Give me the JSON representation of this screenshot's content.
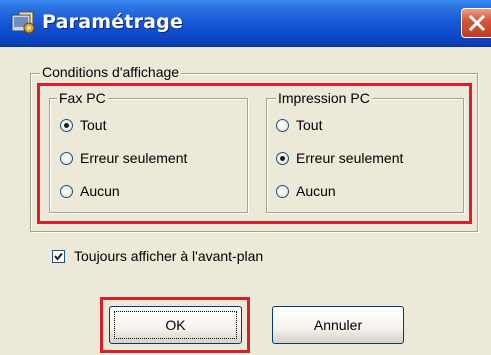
{
  "window": {
    "title": "Paramétrage",
    "app_icon": "settings-app-icon",
    "close_icon": "close-icon",
    "close_color": "#c8432a",
    "titlebar_color": "#1453d4"
  },
  "display_conditions": {
    "legend": "Conditions d'affichage",
    "fax_pc": {
      "legend": "Fax PC",
      "options": [
        "Tout",
        "Erreur seulement",
        "Aucun"
      ],
      "selected": "Tout"
    },
    "print_pc": {
      "legend": "Impression PC",
      "options": [
        "Tout",
        "Erreur seulement",
        "Aucun"
      ],
      "selected": "Erreur seulement"
    }
  },
  "always_on_top": {
    "label": "Toujours afficher à l'avant-plan",
    "checked": true
  },
  "buttons": {
    "ok": "OK",
    "cancel": "Annuler"
  },
  "highlight_color": "#dc1e2a"
}
